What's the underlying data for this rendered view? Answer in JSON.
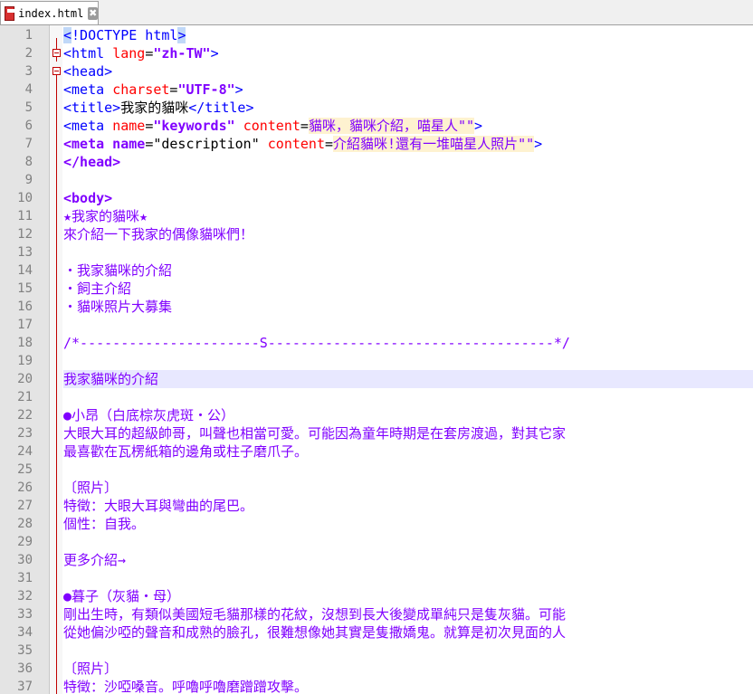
{
  "tab": {
    "filename": "index.html",
    "close_glyph": "✖",
    "icon": "save-file-icon"
  },
  "lines": [
    {
      "n": "1",
      "tokens": [
        {
          "c": "t-tag doc-hl",
          "t": "<"
        },
        {
          "c": "t-tag",
          "t": "!DOCTYPE html"
        },
        {
          "c": "t-tag doc-hl",
          "t": ">"
        }
      ]
    },
    {
      "n": "2",
      "tokens": [
        {
          "c": "t-tag",
          "t": "<html "
        },
        {
          "c": "t-attr",
          "t": "lang"
        },
        {
          "c": "t-text",
          "t": "="
        },
        {
          "c": "t-val",
          "t": "\"zh-TW\""
        },
        {
          "c": "t-tag",
          "t": ">"
        }
      ]
    },
    {
      "n": "3",
      "tokens": [
        {
          "c": "t-tag",
          "t": "<head>"
        }
      ]
    },
    {
      "n": "4",
      "tokens": [
        {
          "c": "t-tag",
          "t": "<meta "
        },
        {
          "c": "t-attr",
          "t": "charset"
        },
        {
          "c": "t-text",
          "t": "="
        },
        {
          "c": "t-val",
          "t": "\"UTF-8\""
        },
        {
          "c": "t-tag",
          "t": ">"
        }
      ]
    },
    {
      "n": "5",
      "tokens": [
        {
          "c": "t-tag",
          "t": "<title>"
        },
        {
          "c": "t-text",
          "t": "我家的貓咪"
        },
        {
          "c": "t-tag",
          "t": "</title>"
        }
      ]
    },
    {
      "n": "6",
      "tokens": [
        {
          "c": "t-tag",
          "t": "<meta "
        },
        {
          "c": "t-attr",
          "t": "name"
        },
        {
          "c": "t-text",
          "t": "="
        },
        {
          "c": "t-val",
          "t": "\"keywords\""
        },
        {
          "c": "t-text",
          "t": " "
        },
        {
          "c": "t-attr",
          "t": "content"
        },
        {
          "c": "t-text",
          "t": "="
        },
        {
          "c": "t-hv",
          "t": "貓咪，貓咪介紹，喵星人\"\""
        },
        {
          "c": "t-tag",
          "t": ">"
        }
      ]
    },
    {
      "n": "7",
      "tokens": [
        {
          "c": "t-bold",
          "t": "<meta name"
        },
        {
          "c": "t-text",
          "t": "=\"description\" "
        },
        {
          "c": "t-attr",
          "t": "content"
        },
        {
          "c": "t-text",
          "t": "="
        },
        {
          "c": "t-hv",
          "t": "介紹貓咪!還有一堆喵星人照片\"\""
        },
        {
          "c": "t-tag",
          "t": ">"
        }
      ]
    },
    {
      "n": "8",
      "tokens": [
        {
          "c": "t-bold",
          "t": "</head>"
        }
      ]
    },
    {
      "n": "9",
      "tokens": []
    },
    {
      "n": "10",
      "tokens": [
        {
          "c": "t-bold",
          "t": "<body>"
        }
      ]
    },
    {
      "n": "11",
      "tokens": [
        {
          "c": "t-mg",
          "t": "★我家的貓咪★"
        }
      ]
    },
    {
      "n": "12",
      "tokens": [
        {
          "c": "t-mg",
          "t": "來介紹一下我家的偶像貓咪們！"
        }
      ]
    },
    {
      "n": "13",
      "tokens": []
    },
    {
      "n": "14",
      "tokens": [
        {
          "c": "t-mg",
          "t": "・我家貓咪的介紹"
        }
      ]
    },
    {
      "n": "15",
      "tokens": [
        {
          "c": "t-mg",
          "t": "・飼主介紹"
        }
      ]
    },
    {
      "n": "16",
      "tokens": [
        {
          "c": "t-mg",
          "t": "・貓咪照片大募集"
        }
      ]
    },
    {
      "n": "17",
      "tokens": []
    },
    {
      "n": "18",
      "tokens": [
        {
          "c": "t-mg",
          "t": "/*----------------------S-----------------------------------*/"
        }
      ]
    },
    {
      "n": "19",
      "tokens": []
    },
    {
      "n": "20",
      "hl": true,
      "tokens": [
        {
          "c": "t-mg",
          "t": "我家貓咪的介紹"
        }
      ]
    },
    {
      "n": "21",
      "tokens": []
    },
    {
      "n": "22",
      "tokens": [
        {
          "c": "t-mg",
          "t": "●小昂（白底棕灰虎斑・公）"
        }
      ]
    },
    {
      "n": "23",
      "tokens": [
        {
          "c": "t-mg",
          "t": "大眼大耳的超級帥哥，叫聲也相當可愛。可能因為童年時期是在套房渡過，對其它家"
        }
      ]
    },
    {
      "n": "24",
      "tokens": [
        {
          "c": "t-mg",
          "t": "最喜歡在瓦楞紙箱的邊角或柱子磨爪子。"
        }
      ]
    },
    {
      "n": "25",
      "tokens": []
    },
    {
      "n": "26",
      "tokens": [
        {
          "c": "t-mg",
          "t": "〔照片〕"
        }
      ]
    },
    {
      "n": "27",
      "tokens": [
        {
          "c": "t-mg",
          "t": "特徵：大眼大耳與彎曲的尾巴。"
        }
      ]
    },
    {
      "n": "28",
      "tokens": [
        {
          "c": "t-mg",
          "t": "個性：自我。"
        }
      ]
    },
    {
      "n": "29",
      "tokens": []
    },
    {
      "n": "30",
      "tokens": [
        {
          "c": "t-mg",
          "t": "更多介紹→"
        }
      ]
    },
    {
      "n": "31",
      "tokens": []
    },
    {
      "n": "32",
      "tokens": [
        {
          "c": "t-mg",
          "t": "●暮子（灰貓・母）"
        }
      ]
    },
    {
      "n": "33",
      "tokens": [
        {
          "c": "t-mg",
          "t": "剛出生時，有類似美國短毛貓那樣的花紋，沒想到長大後變成單純只是隻灰貓。可能"
        }
      ]
    },
    {
      "n": "34",
      "tokens": [
        {
          "c": "t-mg",
          "t": "從她偏沙啞的聲音和成熟的臉孔，很難想像她其實是隻撒嬌鬼。就算是初次見面的人"
        }
      ]
    },
    {
      "n": "35",
      "tokens": []
    },
    {
      "n": "36",
      "tokens": [
        {
          "c": "t-mg",
          "t": "〔照片〕"
        }
      ]
    },
    {
      "n": "37",
      "tokens": [
        {
          "c": "t-mg",
          "t": "特徵：沙啞嗓音。呼嚕呼嚕磨蹭蹭攻擊。"
        }
      ]
    }
  ]
}
